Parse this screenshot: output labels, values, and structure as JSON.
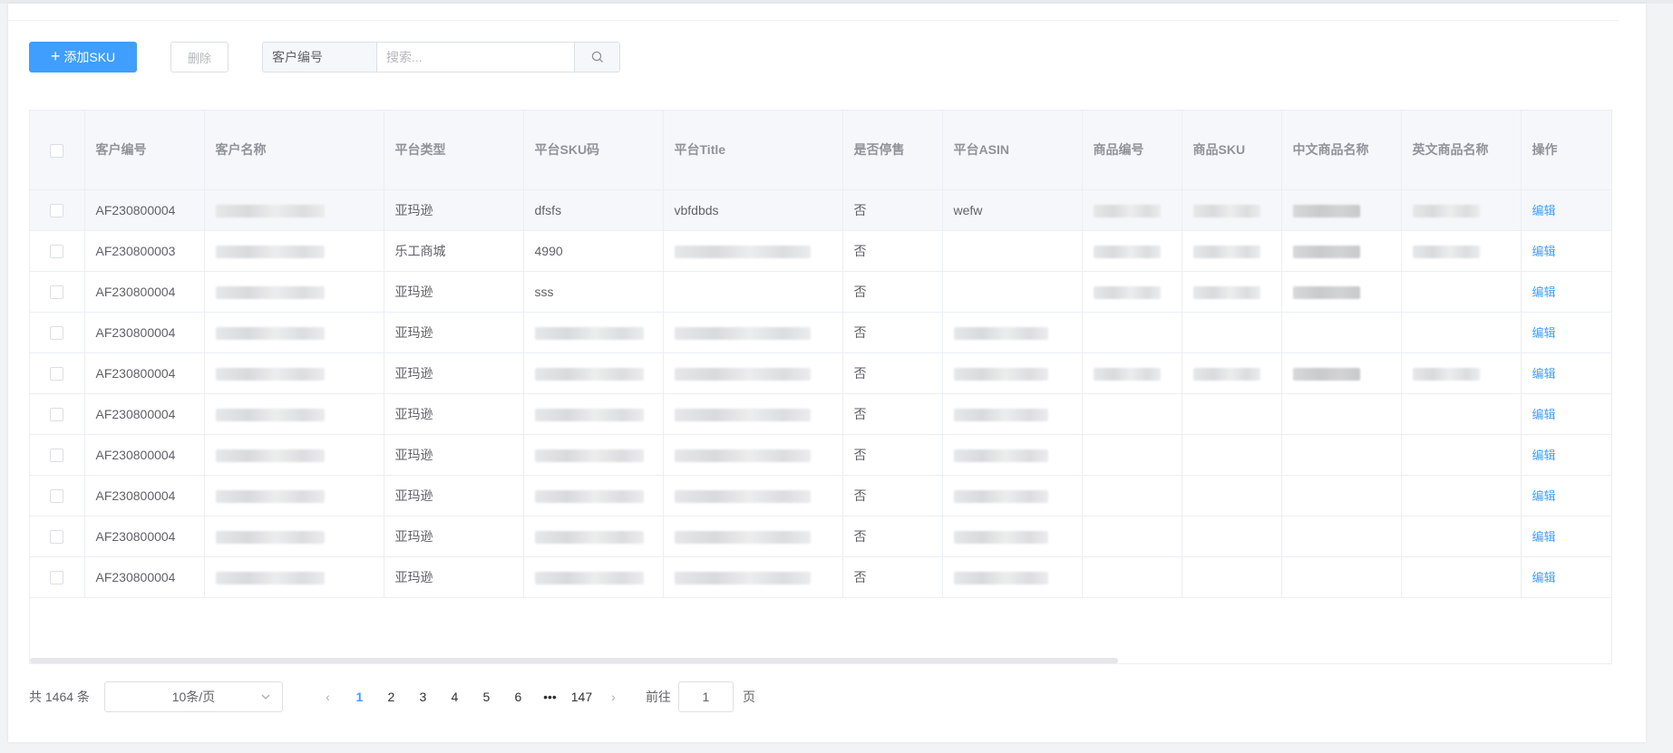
{
  "toolbar": {
    "add_label": "添加SKU",
    "delete_label": "删除",
    "search_field": "客户编号",
    "search_placeholder": "搜索..."
  },
  "table": {
    "headers": [
      "客户编号",
      "客户名称",
      "平台类型",
      "平台SKU码",
      "平台Title",
      "是否停售",
      "平台ASIN",
      "商品编号",
      "商品SKU",
      "中文商品名称",
      "英文商品名称",
      "操作"
    ],
    "rows": [
      {
        "customer_id": "AF230800004",
        "platform": "亚玛逊",
        "sku": "dfsfs",
        "title": "vbfdbds",
        "discontinued": "否",
        "asin": "wefw",
        "action": "编辑"
      },
      {
        "customer_id": "AF230800003",
        "platform": "乐工商城",
        "sku": "4990",
        "title": "",
        "discontinued": "否",
        "asin": "",
        "action": "编辑"
      },
      {
        "customer_id": "AF230800004",
        "platform": "亚玛逊",
        "sku": "sss",
        "title": "",
        "discontinued": "否",
        "asin": "",
        "action": "编辑"
      },
      {
        "customer_id": "AF230800004",
        "platform": "亚玛逊",
        "sku": "",
        "title": "",
        "discontinued": "否",
        "asin": "",
        "action": "编辑"
      },
      {
        "customer_id": "AF230800004",
        "platform": "亚玛逊",
        "sku": "",
        "title": "",
        "discontinued": "否",
        "asin": "",
        "action": "编辑"
      },
      {
        "customer_id": "AF230800004",
        "platform": "亚玛逊",
        "sku": "",
        "title": "",
        "discontinued": "否",
        "asin": "",
        "action": "编辑"
      },
      {
        "customer_id": "AF230800004",
        "platform": "亚玛逊",
        "sku": "",
        "title": "",
        "discontinued": "否",
        "asin": "",
        "action": "编辑"
      },
      {
        "customer_id": "AF230800004",
        "platform": "亚玛逊",
        "sku": "",
        "title": "",
        "discontinued": "否",
        "asin": "",
        "action": "编辑"
      },
      {
        "customer_id": "AF230800004",
        "platform": "亚玛逊",
        "sku": "",
        "title": "",
        "discontinued": "否",
        "asin": "",
        "action": "编辑"
      },
      {
        "customer_id": "AF230800004",
        "platform": "亚玛逊",
        "sku": "",
        "title": "",
        "discontinued": "否",
        "asin": "",
        "action": "编辑"
      }
    ]
  },
  "pagination": {
    "total_text": "共 1464 条",
    "page_size": "10条/页",
    "pages": [
      "1",
      "2",
      "3",
      "4",
      "5",
      "6",
      "•••",
      "147"
    ],
    "current": "1",
    "goto_label": "前往",
    "goto_value": "1",
    "page_suffix": "页"
  },
  "colors": {
    "accent": "#409eff",
    "header_bg": "#f5f7fa",
    "border": "#ebeef5"
  }
}
